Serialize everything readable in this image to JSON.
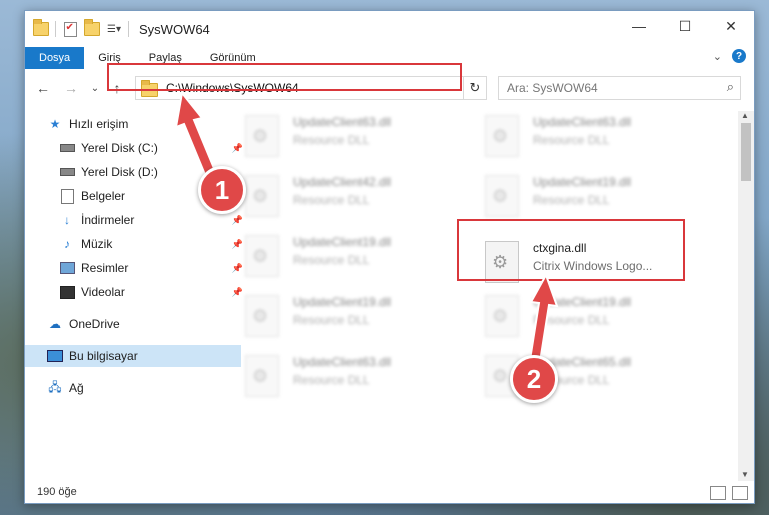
{
  "window": {
    "title": "SysWOW64",
    "controls": {
      "minimize": "—",
      "maximize": "☐",
      "close": "✕"
    }
  },
  "ribbon": {
    "tabs": [
      "Dosya",
      "Giriş",
      "Paylaş",
      "Görünüm"
    ],
    "active_tab": "Dosya",
    "accent": "#1979ca"
  },
  "navigation": {
    "back": "←",
    "forward": "→",
    "recent": "⌄",
    "up": "↑",
    "address": "C:\\Windows\\SysWOW64",
    "search_placeholder": "Ara: SysWOW64"
  },
  "sidebar": {
    "items": [
      {
        "label": "Hızlı erişim",
        "icon": "star-icon",
        "pinned": false
      },
      {
        "label": "Yerel Disk (C:)",
        "icon": "drive-icon",
        "pinned": true
      },
      {
        "label": "Yerel Disk (D:)",
        "icon": "drive-icon",
        "pinned": false
      },
      {
        "label": "Belgeler",
        "icon": "documents-icon",
        "pinned": true
      },
      {
        "label": "İndirmeler",
        "icon": "download-icon",
        "pinned": true
      },
      {
        "label": "Müzik",
        "icon": "music-icon",
        "pinned": true
      },
      {
        "label": "Resimler",
        "icon": "pictures-icon",
        "pinned": true
      },
      {
        "label": "Videolar",
        "icon": "videos-icon",
        "pinned": true
      },
      {
        "label": "OneDrive",
        "icon": "cloud-icon",
        "pinned": false
      },
      {
        "label": "Bu bilgisayar",
        "icon": "computer-icon",
        "pinned": false,
        "selected": true
      },
      {
        "label": "Ağ",
        "icon": "network-icon",
        "pinned": false
      }
    ]
  },
  "files": {
    "left": [
      {
        "name": "UpdateClient63.dll",
        "desc": "Resource DLL"
      },
      {
        "name": "UpdateClient42.dll",
        "desc": "Resource DLL"
      },
      {
        "name": "UpdateClient19.dll",
        "desc": "Resource DLL"
      },
      {
        "name": "UpdateClient19.dll",
        "desc": "Resource DLL"
      },
      {
        "name": "UpdateClient63.dll",
        "desc": "Resource DLL"
      }
    ],
    "right": [
      {
        "name": "UpdateClient63.dll",
        "desc": "Resource DLL"
      },
      {
        "name": "UpdateClient19.dll",
        "desc": "Resource DLL"
      },
      {
        "name": "ctxgina.dll",
        "desc": "Citrix Windows Logo...",
        "highlighted": true
      },
      {
        "name": "UpdateClient19.dll",
        "desc": "Resource DLL"
      },
      {
        "name": "UpdateClient65.dll",
        "desc": "Resource DLL"
      }
    ]
  },
  "status": {
    "item_count": "190 öğe"
  },
  "annotations": {
    "badge1": "1",
    "badge2": "2",
    "color": "#e04848"
  }
}
